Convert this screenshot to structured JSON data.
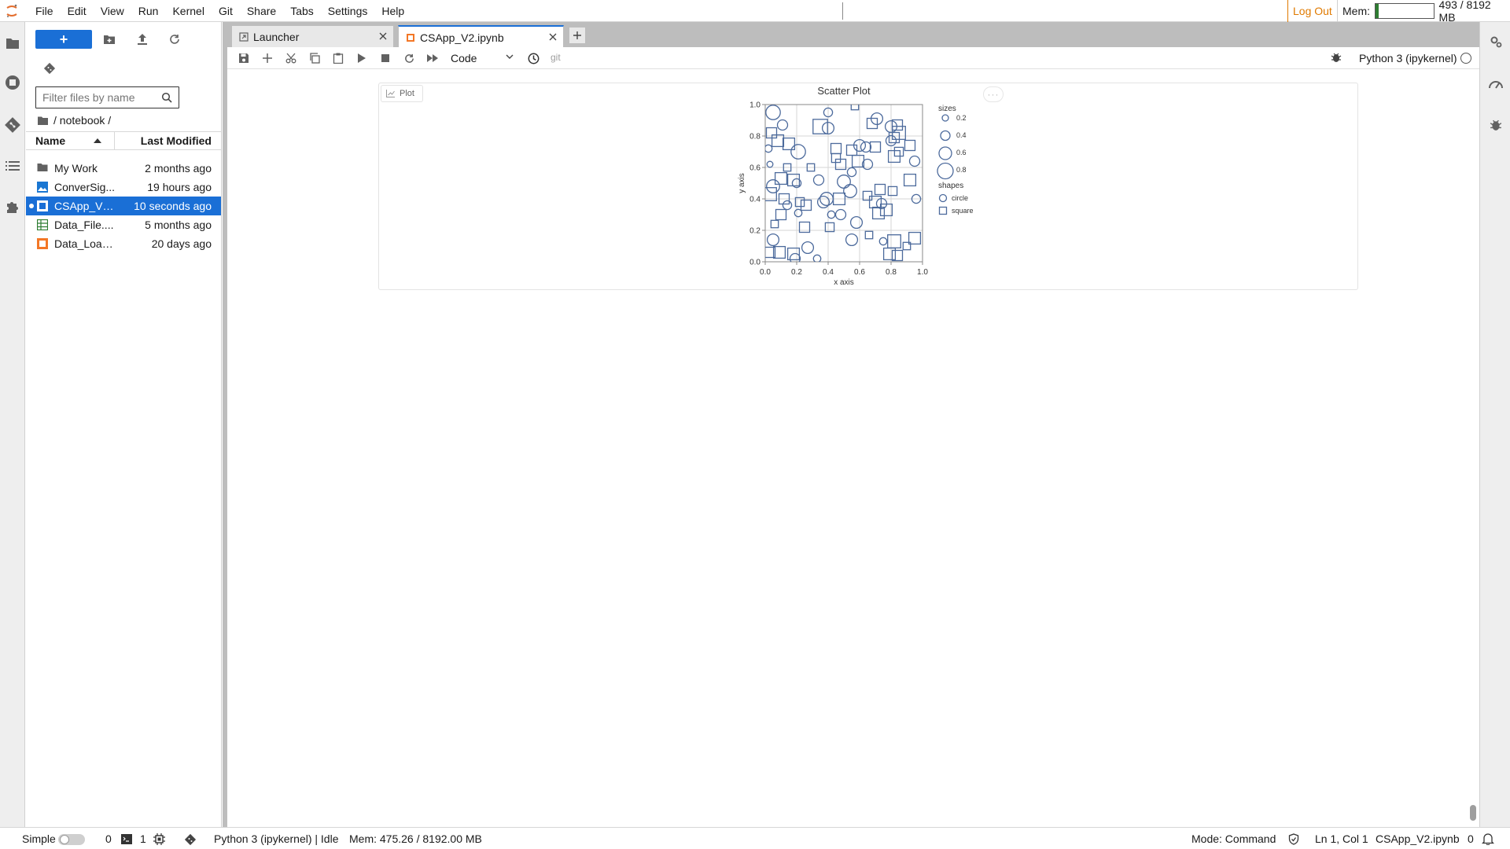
{
  "menubar": {
    "items": [
      "File",
      "Edit",
      "View",
      "Run",
      "Kernel",
      "Git",
      "Share",
      "Tabs",
      "Settings",
      "Help"
    ],
    "logout_label": "Log Out",
    "mem_label": "Mem:",
    "mem_value": "493 / 8192 MB",
    "mem_fraction": 0.06
  },
  "colors": {
    "accent": "#1a6fd6",
    "logout": "#e07a00",
    "mem_fill": "#2e7d32",
    "chart_marks": "#4c6a9c"
  },
  "filebrowser": {
    "new_label": "+",
    "filter_placeholder": "Filter files by name",
    "breadcrumb": "/ notebook /",
    "col_name": "Name",
    "col_modified": "Last Modified",
    "files": [
      {
        "name": "My Work",
        "modified": "2 months ago",
        "icon": "folder-icon",
        "selected": false
      },
      {
        "name": "ConverSig...",
        "modified": "19 hours ago",
        "icon": "image-file-icon",
        "selected": false
      },
      {
        "name": "CSApp_V2...",
        "modified": "10 seconds ago",
        "icon": "notebook-icon",
        "selected": true
      },
      {
        "name": "Data_File....",
        "modified": "5 months ago",
        "icon": "spreadsheet-icon",
        "selected": false
      },
      {
        "name": "Data_Load...",
        "modified": "20 days ago",
        "icon": "notebook-orange-icon",
        "selected": false
      }
    ]
  },
  "tabs": [
    {
      "label": "Launcher",
      "icon": "launcher-icon"
    },
    {
      "label": "CSApp_V2.ipynb",
      "icon": "notebook-tab-icon"
    }
  ],
  "toolbar": {
    "cell_type": "Code",
    "git_label": "git",
    "kernel_name": "Python 3 (ipykernel)"
  },
  "output": {
    "plot_tab_label": "Plot",
    "more_label": "···"
  },
  "chart_data": {
    "type": "scatter",
    "title": "Scatter Plot",
    "xlabel": "x axis",
    "ylabel": "y axis",
    "xlim": [
      0,
      1
    ],
    "ylim": [
      0,
      1
    ],
    "xticks": [
      "0.0",
      "0.2",
      "0.4",
      "0.6",
      "0.8",
      "1.0"
    ],
    "yticks": [
      "0.0",
      "0.2",
      "0.4",
      "0.6",
      "0.8",
      "1.0"
    ],
    "grid": true,
    "legend": {
      "placement": "right",
      "size_title": "sizes",
      "sizes": [
        "0.2",
        "0.4",
        "0.6",
        "0.8"
      ],
      "shape_title": "shapes",
      "shapes": [
        "circle",
        "square"
      ]
    },
    "points": [
      {
        "x": 0.05,
        "y": 0.95,
        "size": 0.8,
        "shape": "circle"
      },
      {
        "x": 0.11,
        "y": 0.87,
        "size": 0.5,
        "shape": "circle"
      },
      {
        "x": 0.04,
        "y": 0.82,
        "size": 0.5,
        "shape": "square"
      },
      {
        "x": 0.08,
        "y": 0.77,
        "size": 0.6,
        "shape": "square"
      },
      {
        "x": 0.21,
        "y": 0.7,
        "size": 0.8,
        "shape": "circle"
      },
      {
        "x": 0.15,
        "y": 0.75,
        "size": 0.6,
        "shape": "square"
      },
      {
        "x": 0.35,
        "y": 0.86,
        "size": 0.8,
        "shape": "square"
      },
      {
        "x": 0.4,
        "y": 0.85,
        "size": 0.6,
        "shape": "circle"
      },
      {
        "x": 0.4,
        "y": 0.95,
        "size": 0.4,
        "shape": "circle"
      },
      {
        "x": 0.57,
        "y": 0.99,
        "size": 0.3,
        "shape": "square"
      },
      {
        "x": 0.71,
        "y": 0.91,
        "size": 0.6,
        "shape": "circle"
      },
      {
        "x": 0.68,
        "y": 0.88,
        "size": 0.5,
        "shape": "square"
      },
      {
        "x": 0.8,
        "y": 0.86,
        "size": 0.6,
        "shape": "circle"
      },
      {
        "x": 0.84,
        "y": 0.87,
        "size": 0.5,
        "shape": "square"
      },
      {
        "x": 0.85,
        "y": 0.82,
        "size": 0.7,
        "shape": "square"
      },
      {
        "x": 0.8,
        "y": 0.77,
        "size": 0.5,
        "shape": "circle"
      },
      {
        "x": 0.82,
        "y": 0.79,
        "size": 0.5,
        "shape": "square"
      },
      {
        "x": 0.6,
        "y": 0.74,
        "size": 0.6,
        "shape": "circle"
      },
      {
        "x": 0.64,
        "y": 0.73,
        "size": 0.5,
        "shape": "circle"
      },
      {
        "x": 0.7,
        "y": 0.73,
        "size": 0.5,
        "shape": "square"
      },
      {
        "x": 0.55,
        "y": 0.71,
        "size": 0.5,
        "shape": "square"
      },
      {
        "x": 0.45,
        "y": 0.72,
        "size": 0.5,
        "shape": "square"
      },
      {
        "x": 0.45,
        "y": 0.66,
        "size": 0.4,
        "shape": "square"
      },
      {
        "x": 0.48,
        "y": 0.62,
        "size": 0.5,
        "shape": "square"
      },
      {
        "x": 0.55,
        "y": 0.57,
        "size": 0.4,
        "shape": "circle"
      },
      {
        "x": 0.59,
        "y": 0.64,
        "size": 0.6,
        "shape": "square"
      },
      {
        "x": 0.65,
        "y": 0.62,
        "size": 0.5,
        "shape": "circle"
      },
      {
        "x": 0.82,
        "y": 0.67,
        "size": 0.6,
        "shape": "square"
      },
      {
        "x": 0.85,
        "y": 0.7,
        "size": 0.4,
        "shape": "square"
      },
      {
        "x": 0.95,
        "y": 0.64,
        "size": 0.5,
        "shape": "circle"
      },
      {
        "x": 0.92,
        "y": 0.52,
        "size": 0.6,
        "shape": "square"
      },
      {
        "x": 0.92,
        "y": 0.74,
        "size": 0.5,
        "shape": "square"
      },
      {
        "x": 0.14,
        "y": 0.6,
        "size": 0.3,
        "shape": "square"
      },
      {
        "x": 0.03,
        "y": 0.62,
        "size": 0.2,
        "shape": "circle"
      },
      {
        "x": 0.02,
        "y": 0.72,
        "size": 0.3,
        "shape": "circle"
      },
      {
        "x": 0.18,
        "y": 0.52,
        "size": 0.6,
        "shape": "square"
      },
      {
        "x": 0.2,
        "y": 0.5,
        "size": 0.4,
        "shape": "circle"
      },
      {
        "x": 0.1,
        "y": 0.53,
        "size": 0.6,
        "shape": "square"
      },
      {
        "x": 0.05,
        "y": 0.48,
        "size": 0.7,
        "shape": "circle"
      },
      {
        "x": 0.03,
        "y": 0.43,
        "size": 0.7,
        "shape": "square"
      },
      {
        "x": 0.34,
        "y": 0.52,
        "size": 0.5,
        "shape": "circle"
      },
      {
        "x": 0.29,
        "y": 0.6,
        "size": 0.3,
        "shape": "square"
      },
      {
        "x": 0.5,
        "y": 0.51,
        "size": 0.7,
        "shape": "circle"
      },
      {
        "x": 0.54,
        "y": 0.45,
        "size": 0.7,
        "shape": "circle"
      },
      {
        "x": 0.47,
        "y": 0.4,
        "size": 0.6,
        "shape": "square"
      },
      {
        "x": 0.39,
        "y": 0.4,
        "size": 0.7,
        "shape": "circle"
      },
      {
        "x": 0.37,
        "y": 0.38,
        "size": 0.6,
        "shape": "circle"
      },
      {
        "x": 0.26,
        "y": 0.36,
        "size": 0.5,
        "shape": "square"
      },
      {
        "x": 0.22,
        "y": 0.38,
        "size": 0.4,
        "shape": "square"
      },
      {
        "x": 0.14,
        "y": 0.36,
        "size": 0.4,
        "shape": "circle"
      },
      {
        "x": 0.12,
        "y": 0.4,
        "size": 0.5,
        "shape": "square"
      },
      {
        "x": 0.21,
        "y": 0.31,
        "size": 0.3,
        "shape": "circle"
      },
      {
        "x": 0.65,
        "y": 0.42,
        "size": 0.4,
        "shape": "square"
      },
      {
        "x": 0.7,
        "y": 0.38,
        "size": 0.6,
        "shape": "square"
      },
      {
        "x": 0.74,
        "y": 0.37,
        "size": 0.5,
        "shape": "circle"
      },
      {
        "x": 0.72,
        "y": 0.31,
        "size": 0.6,
        "shape": "square"
      },
      {
        "x": 0.77,
        "y": 0.33,
        "size": 0.6,
        "shape": "square"
      },
      {
        "x": 0.81,
        "y": 0.45,
        "size": 0.4,
        "shape": "square"
      },
      {
        "x": 0.73,
        "y": 0.46,
        "size": 0.5,
        "shape": "square"
      },
      {
        "x": 0.96,
        "y": 0.4,
        "size": 0.4,
        "shape": "circle"
      },
      {
        "x": 0.48,
        "y": 0.3,
        "size": 0.5,
        "shape": "circle"
      },
      {
        "x": 0.42,
        "y": 0.3,
        "size": 0.3,
        "shape": "circle"
      },
      {
        "x": 0.58,
        "y": 0.25,
        "size": 0.6,
        "shape": "circle"
      },
      {
        "x": 0.55,
        "y": 0.14,
        "size": 0.6,
        "shape": "circle"
      },
      {
        "x": 0.41,
        "y": 0.22,
        "size": 0.4,
        "shape": "square"
      },
      {
        "x": 0.25,
        "y": 0.22,
        "size": 0.5,
        "shape": "square"
      },
      {
        "x": 0.1,
        "y": 0.3,
        "size": 0.5,
        "shape": "square"
      },
      {
        "x": 0.05,
        "y": 0.14,
        "size": 0.6,
        "shape": "circle"
      },
      {
        "x": 0.03,
        "y": 0.06,
        "size": 0.5,
        "shape": "square"
      },
      {
        "x": 0.09,
        "y": 0.06,
        "size": 0.6,
        "shape": "square"
      },
      {
        "x": 0.18,
        "y": 0.05,
        "size": 0.6,
        "shape": "square"
      },
      {
        "x": 0.19,
        "y": 0.02,
        "size": 0.5,
        "shape": "circle"
      },
      {
        "x": 0.27,
        "y": 0.09,
        "size": 0.6,
        "shape": "circle"
      },
      {
        "x": 0.33,
        "y": 0.02,
        "size": 0.3,
        "shape": "circle"
      },
      {
        "x": 0.66,
        "y": 0.17,
        "size": 0.3,
        "shape": "square"
      },
      {
        "x": 0.82,
        "y": 0.13,
        "size": 0.7,
        "shape": "square"
      },
      {
        "x": 0.79,
        "y": 0.05,
        "size": 0.6,
        "shape": "square"
      },
      {
        "x": 0.84,
        "y": 0.04,
        "size": 0.5,
        "shape": "square"
      },
      {
        "x": 0.95,
        "y": 0.15,
        "size": 0.6,
        "shape": "square"
      },
      {
        "x": 0.75,
        "y": 0.13,
        "size": 0.3,
        "shape": "circle"
      },
      {
        "x": 0.9,
        "y": 0.1,
        "size": 0.3,
        "shape": "square"
      },
      {
        "x": 0.06,
        "y": 0.24,
        "size": 0.3,
        "shape": "square"
      }
    ]
  },
  "statusbar": {
    "mode_simple": "Simple",
    "terminals": "0",
    "kernels": "1",
    "kernel_status": "Python 3 (ipykernel) | Idle",
    "mem": "Mem: 475.26 / 8192.00 MB",
    "mode": "Mode: Command",
    "cursor": "Ln 1, Col 1",
    "filename": "CSApp_V2.ipynb",
    "notifications": "0"
  }
}
